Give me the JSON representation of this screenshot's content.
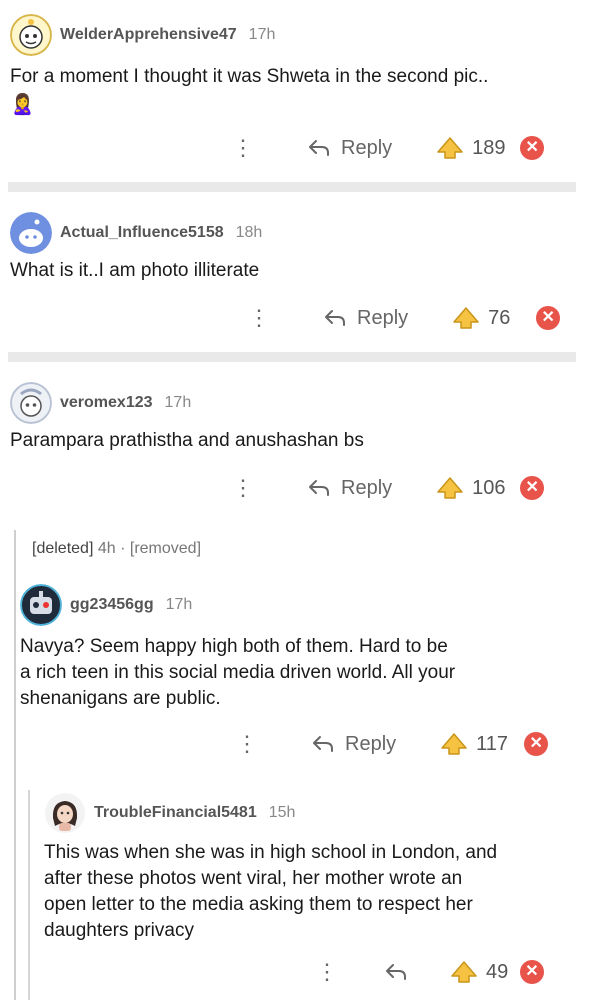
{
  "comments": [
    {
      "username": "WelderApprehensive47",
      "age": "17h",
      "body": "For a moment I thought it was Shweta in the second pic..",
      "emoji": "🙎‍♀️",
      "reply_label": "Reply",
      "score": "189",
      "downvote_symbol": "✕"
    },
    {
      "username": "Actual_Influence5158",
      "age": "18h",
      "body": "What is it..I am photo illiterate",
      "reply_label": "Reply",
      "score": "76",
      "downvote_symbol": "✕"
    },
    {
      "username": "veromex123",
      "age": "17h",
      "body": "Parampara prathistha and anushashan bs",
      "reply_label": "Reply",
      "score": "106",
      "downvote_symbol": "✕"
    },
    {
      "username": "gg23456gg",
      "age": "17h",
      "body_lines": [
        "Navya? Seem happy high both of them. Hard to be",
        "a rich teen in this social media driven world. All your",
        "shenanigans are public."
      ],
      "reply_label": "Reply",
      "score": "117",
      "downvote_symbol": "✕"
    },
    {
      "username": "TroubleFinancial5481",
      "age": "15h",
      "body_lines": [
        "This was when she was in high school in London, and",
        "after these photos went viral, her mother wrote an",
        "open letter to the media asking them to respect her",
        "daughters privacy"
      ],
      "score": "49",
      "downvote_symbol": "✕"
    }
  ],
  "deleted": {
    "user": "[deleted]",
    "age": "4h",
    "separator": "·",
    "status": "[removed]"
  },
  "colors": {
    "upvote": "#f5c242",
    "downvote": "#e8534a",
    "divider": "#e9e9e9"
  }
}
